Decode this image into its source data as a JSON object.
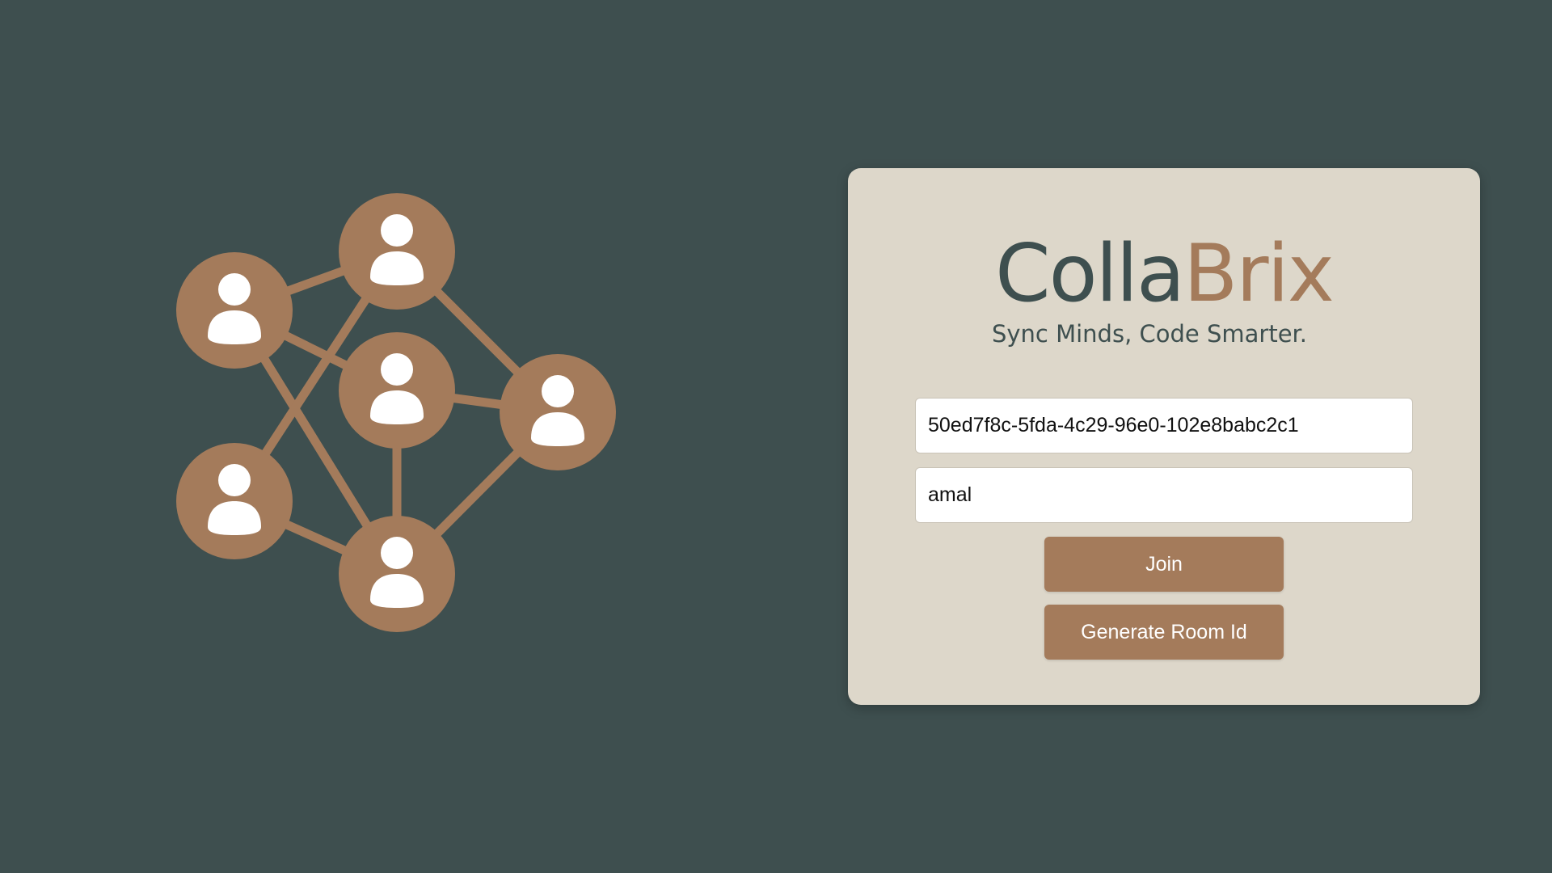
{
  "brand": {
    "name_part_1": "Colla",
    "name_part_2": "Brix",
    "tagline": "Sync Minds, Code Smarter."
  },
  "form": {
    "room_id_value": "50ed7f8c-5fda-4c29-96e0-102e8babc2c1",
    "username_value": "amal",
    "join_label": "Join",
    "generate_label": "Generate Room Id"
  },
  "illustration": {
    "icon": "people-network-icon",
    "node_count": 6
  },
  "colors": {
    "background": "#3e4f4f",
    "card": "#ddd7ca",
    "accent": "#a47b5b",
    "brand_dark": "#3e4f4f"
  }
}
